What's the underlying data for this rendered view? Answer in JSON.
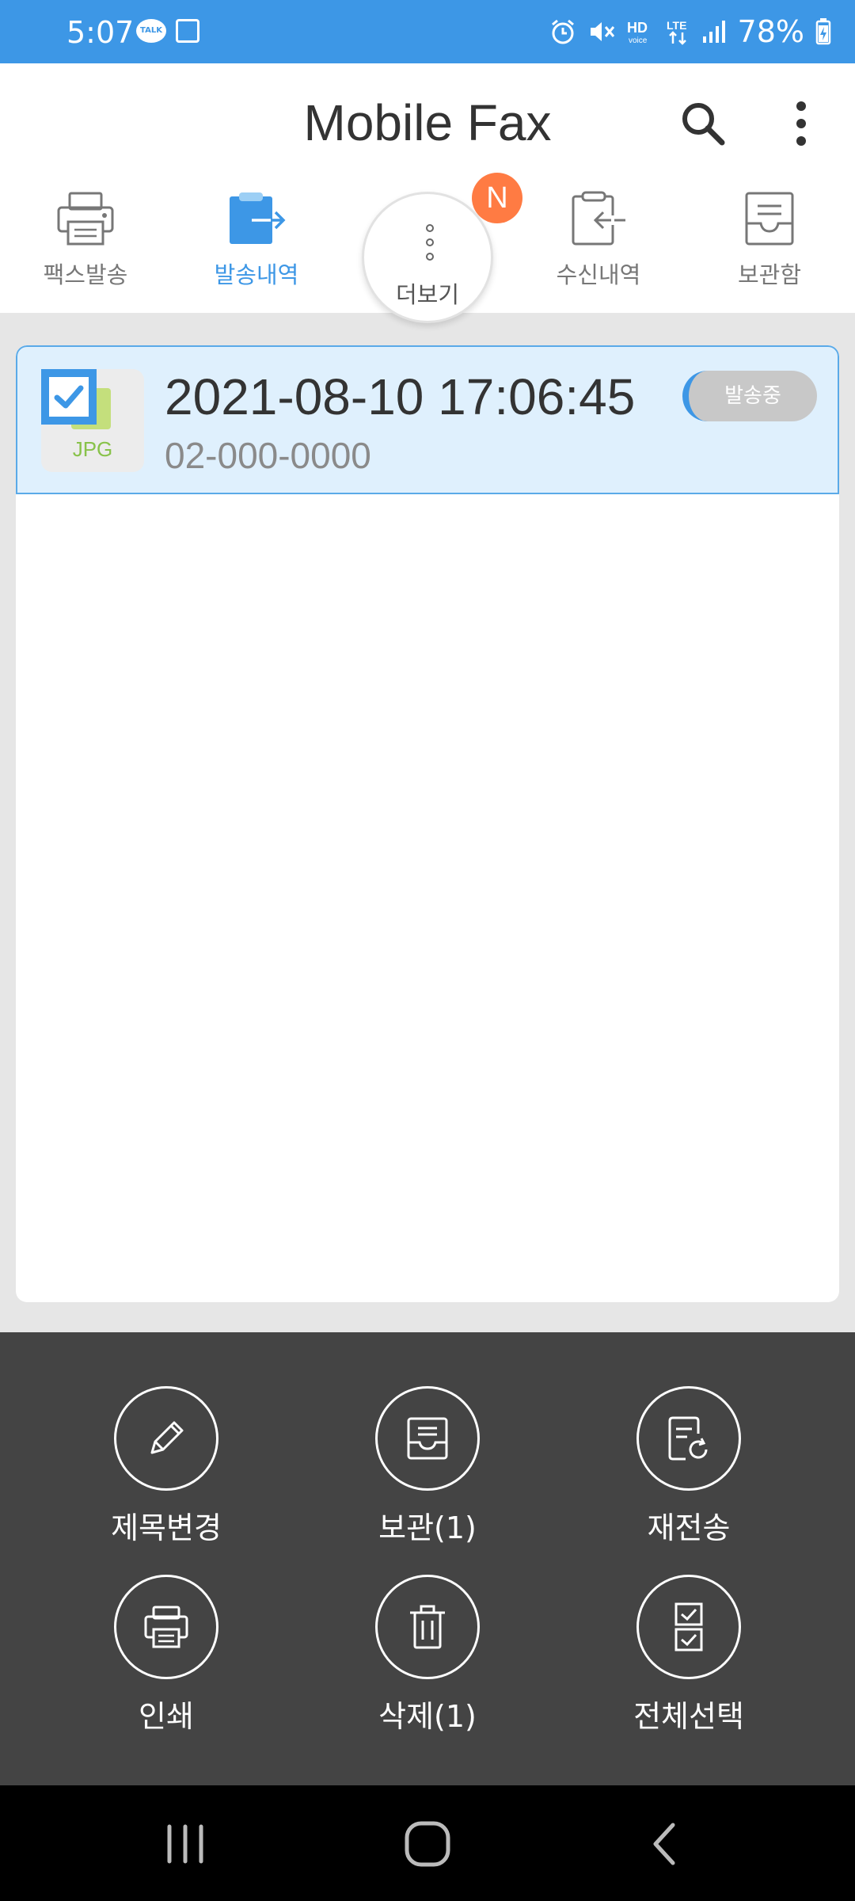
{
  "status_bar": {
    "time": "5:07",
    "talk_badge": "TALK",
    "battery": "78%",
    "icons": [
      "kakaotalk-icon",
      "gallery-icon",
      "alarm-icon",
      "mute-icon",
      "hd-voice-icon",
      "lte-icon",
      "signal-icon",
      "battery-charging-icon"
    ]
  },
  "app_bar": {
    "title": "Mobile Fax",
    "search_icon": "search-icon",
    "more_icon": "more-vert-icon"
  },
  "tabs": [
    {
      "label": "팩스발송",
      "icon": "printer-icon",
      "active": false
    },
    {
      "label": "발송내역",
      "icon": "sent-icon",
      "active": true
    },
    {
      "label": "더보기",
      "icon": "more-dots-icon",
      "active": false,
      "badge": "N"
    },
    {
      "label": "수신내역",
      "icon": "received-icon",
      "active": false
    },
    {
      "label": "보관함",
      "icon": "archive-icon",
      "active": false
    }
  ],
  "list": {
    "items": [
      {
        "date": "2021-08-10 17:06:45",
        "number": "02-000-0000",
        "file_type": "JPG",
        "status": "발송중",
        "checked": true
      }
    ]
  },
  "actions": [
    {
      "label": "제목변경",
      "icon": "pencil-icon"
    },
    {
      "label": "보관(1)",
      "icon": "archive-icon"
    },
    {
      "label": "재전송",
      "icon": "resend-icon"
    },
    {
      "label": "인쇄",
      "icon": "print-icon"
    },
    {
      "label": "삭제(1)",
      "icon": "trash-icon"
    },
    {
      "label": "전체선택",
      "icon": "select-all-icon"
    }
  ],
  "colors": {
    "accent": "#3d97e6",
    "badge": "#ff7b43",
    "sheet": "#444444",
    "row_selected": "#dff0fd"
  }
}
